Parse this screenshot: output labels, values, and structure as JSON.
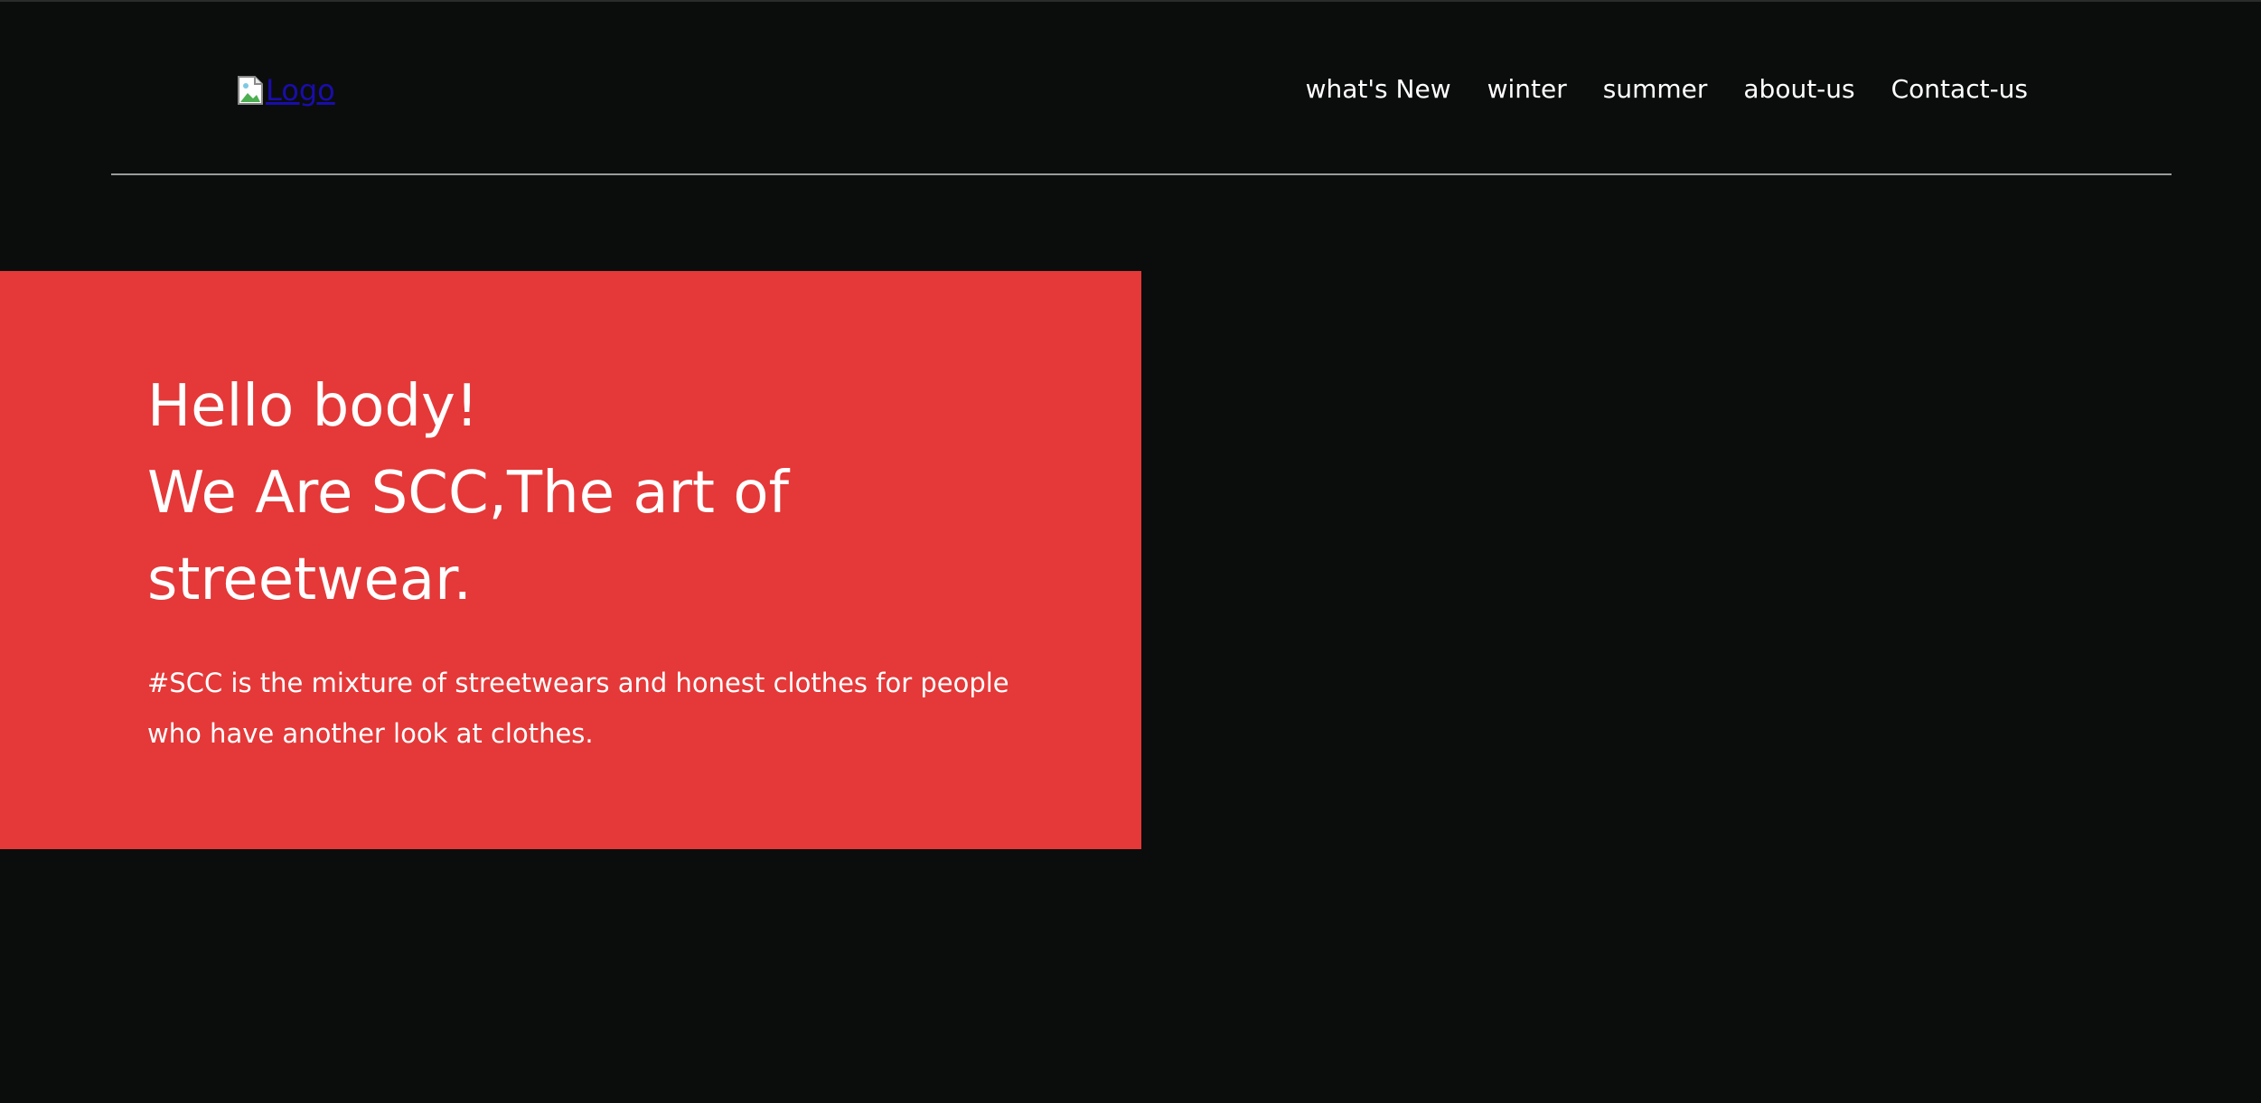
{
  "header": {
    "logo_alt": "Logo",
    "nav": [
      {
        "label": "what's New"
      },
      {
        "label": "winter"
      },
      {
        "label": "summer"
      },
      {
        "label": "about-us"
      },
      {
        "label": "Contact-us"
      }
    ]
  },
  "hero": {
    "title_line1": "Hello body!",
    "title_line2": "We Are SCC,The art of",
    "title_line3": "streetwear.",
    "description": "#SCC is the mixture of streetwears and honest clothes for people who have another look at clothes."
  },
  "colors": {
    "background": "#0b0d0c",
    "hero_background": "#e53838",
    "divider": "#9a9c9b",
    "text": "#ffffff",
    "link": "#1a0dab"
  },
  "icons": {
    "logo_image": "broken-image-icon"
  }
}
